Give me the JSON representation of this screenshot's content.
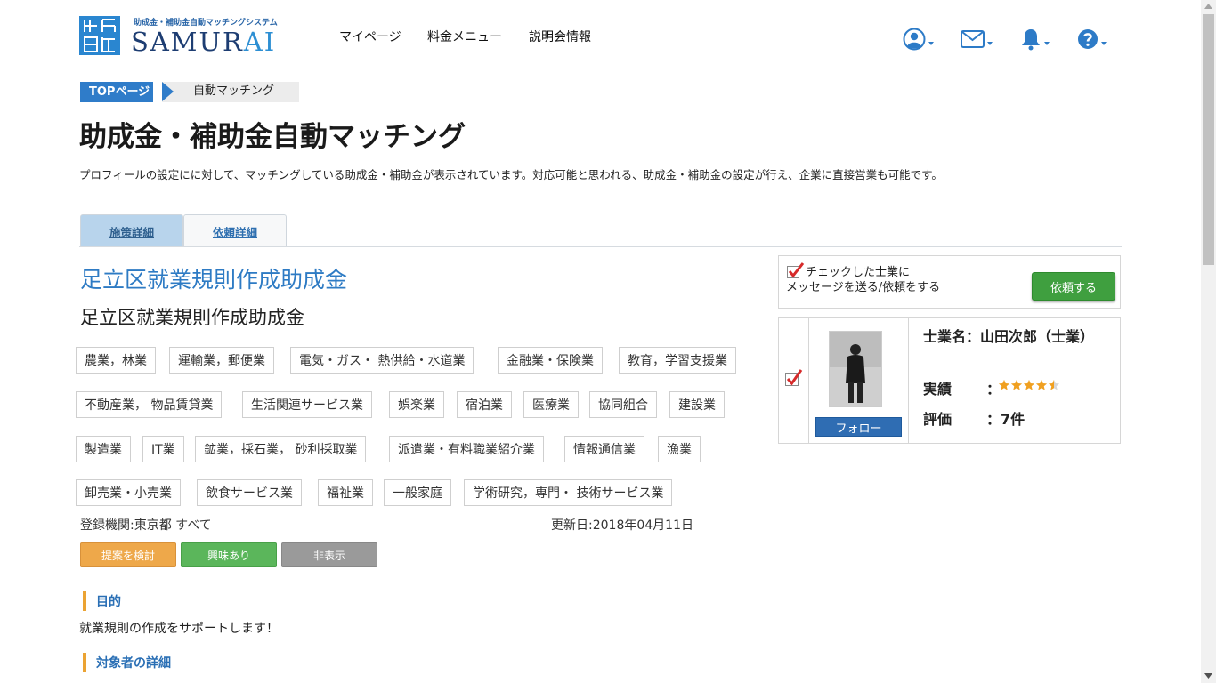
{
  "header": {
    "logo_subtitle": "助成金・補助金自動マッチングシステム",
    "logo_main": "SAMUR",
    "logo_accent": "AI",
    "nav": [
      "マイページ",
      "料金メニュー",
      "説明会情報"
    ],
    "icons": [
      "user-icon",
      "mail-icon",
      "bell-icon",
      "help-icon"
    ]
  },
  "breadcrumb": {
    "home": "TOPページ",
    "current": "自動マッチング"
  },
  "page": {
    "title": "助成金・補助金自動マッチング",
    "description": "プロフィールの設定にに対して、マッチングしている助成金・補助金が表示されています。対応可能と思われる、助成金・補助金の設定が行え、企業に直接営業も可能です。"
  },
  "tabs": [
    "施策詳細",
    "依頼詳細"
  ],
  "grant": {
    "title": "足立区就業規則作成助成金",
    "subtitle": "足立区就業規則作成助成金",
    "tags": [
      "農業，林業",
      "運輸業，郵便業",
      "電気・ガス・ 熱供給・水道業",
      "金融業・保険業",
      "教育，学習支援業",
      "不動産業， 物品賃貸業",
      "生活関連サービス業",
      "娯楽業",
      "宿泊業",
      "医療業",
      "協同組合",
      "建設業",
      "製造業",
      "IT業",
      "鉱業，採石業， 砂利採取業",
      "派遣業・有料職業紹介業",
      "情報通信業",
      "漁業",
      "卸売業・小売業",
      "飲食サービス業",
      "福祉業",
      "一般家庭",
      "学術研究，専門・ 技術サービス業"
    ],
    "registration": "登録機関:東京都 すべて",
    "updated": "更新日:2018年04月11日",
    "buttons": {
      "propose": "提案を検討",
      "interested": "興味あり",
      "hide": "非表示"
    },
    "sections": [
      {
        "title": "目的",
        "body": "就業規則の作成をサポートします！"
      },
      {
        "title": "対象者の詳細",
        "body": ""
      }
    ]
  },
  "side": {
    "notice_line1": "チェックした士業に",
    "notice_line2": "メッセージを送る/依頼をする",
    "request_button": "依頼する",
    "follow_button": "フォロー",
    "name_label": "士業名：山田次郎（士業）",
    "record_label": "実績",
    "record_colon": "：",
    "rating_stars": 4.5,
    "rating_label": "評価",
    "rating_value": "：7件"
  },
  "colors": {
    "accent": "#2e7bc4",
    "orange": "#eea84a",
    "green": "#5bb65b",
    "gray": "#9a9a9a",
    "check": "#d62a2a"
  }
}
